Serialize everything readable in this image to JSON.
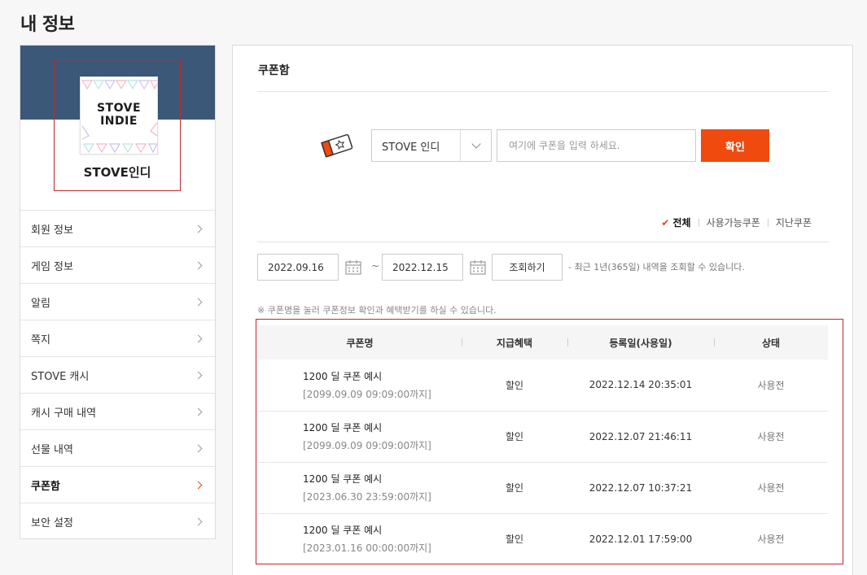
{
  "page": {
    "title": "내 정보"
  },
  "profile": {
    "name": "STOVE인디",
    "logo_text_line1": "STOVE",
    "logo_text_line2": "INDIE"
  },
  "sidebar": {
    "items": [
      {
        "label": "회원 정보",
        "active": false
      },
      {
        "label": "게임 정보",
        "active": false
      },
      {
        "label": "알림",
        "active": false
      },
      {
        "label": "쪽지",
        "active": false
      },
      {
        "label": "STOVE 캐시",
        "active": false
      },
      {
        "label": "캐시 구매 내역",
        "active": false
      },
      {
        "label": "선물 내역",
        "active": false
      },
      {
        "label": "쿠폰함",
        "active": true
      },
      {
        "label": "보안 설정",
        "active": false
      }
    ]
  },
  "coupon": {
    "section_title": "쿠폰함",
    "select_value": "STOVE 인디",
    "input_placeholder": "여기에 쿠폰을 입력 하세요.",
    "confirm_label": "확인"
  },
  "filters": {
    "all": "전체",
    "available": "사용가능쿠폰",
    "past": "지난쿠폰"
  },
  "search": {
    "start_date": "2022.09.16",
    "tilde": "~",
    "end_date": "2022.12.15",
    "button_label": "조회하기",
    "range_note": "- 최근 1년(365일) 내역을 조회할 수 있습니다."
  },
  "notice": "※ 쿠폰명을 눌러 쿠폰정보 확인과 혜택받기를 하실 수 있습니다.",
  "table": {
    "headers": [
      "쿠폰명",
      "지급혜택",
      "등록일(사용일)",
      "상태"
    ],
    "rows": [
      {
        "name": "1200 딜 쿠폰 예시",
        "expiry": "[2099.09.09 09:09:00까지]",
        "benefit": "할인",
        "date": "2022.12.14 20:35:01",
        "status": "사용전"
      },
      {
        "name": "1200 딜 쿠폰 예시",
        "expiry": "[2099.09.09 09:09:00까지]",
        "benefit": "할인",
        "date": "2022.12.07 21:46:11",
        "status": "사용전"
      },
      {
        "name": "1200 딜 쿠폰 예시",
        "expiry": "[2023.06.30 23:59:00까지]",
        "benefit": "할인",
        "date": "2022.12.07 10:37:21",
        "status": "사용전"
      },
      {
        "name": "1200 딜 쿠폰 예시",
        "expiry": "[2023.01.16 00:00:00까지]",
        "benefit": "할인",
        "date": "2022.12.01 17:59:00",
        "status": "사용전"
      }
    ]
  },
  "colors": {
    "accent": "#f04a0e",
    "profile_band": "#3b5878",
    "highlight_border": "#c0282d"
  }
}
